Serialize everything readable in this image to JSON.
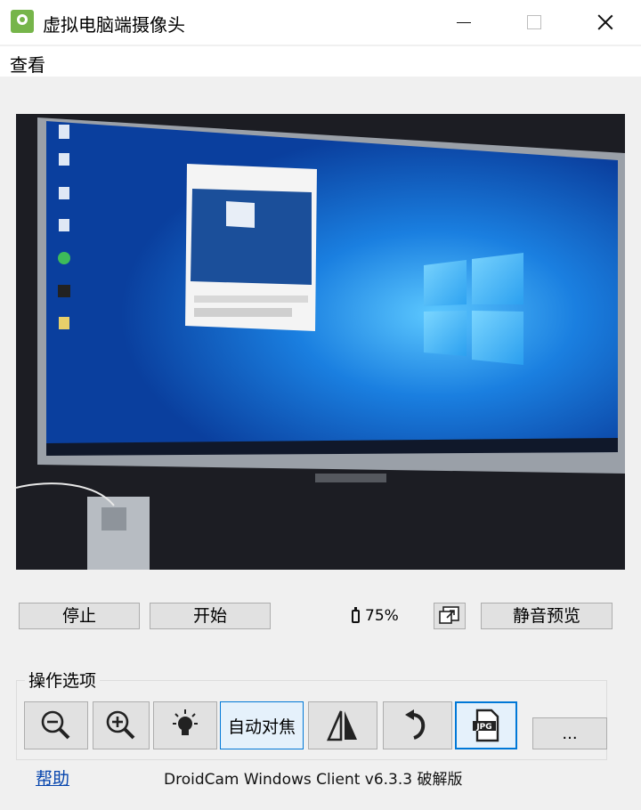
{
  "window": {
    "title": "虚拟电脑端摄像头"
  },
  "menu": {
    "view": "查看"
  },
  "controls": {
    "stop": "停止",
    "start": "开始",
    "battery": "75%",
    "mute_preview": "静音预览"
  },
  "options": {
    "group_label": "操作选项",
    "autofocus": "自动对焦",
    "more": "..."
  },
  "footer": {
    "help": "帮助",
    "version": "DroidCam Windows Client v6.3.3 破解版"
  },
  "colors": {
    "accent": "#0078d7",
    "win_blue": "#1478d4",
    "app_icon": "#76b54a"
  }
}
